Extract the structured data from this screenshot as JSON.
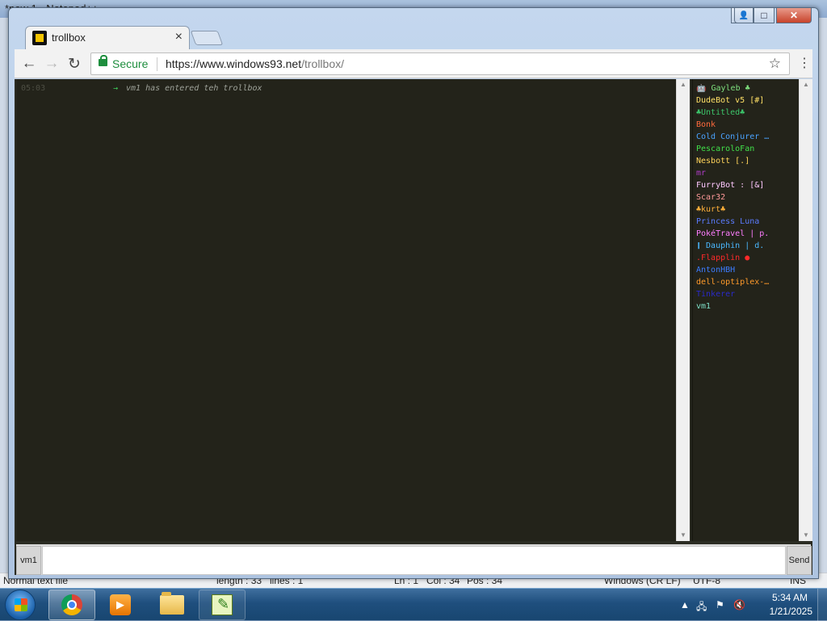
{
  "background_app": {
    "title": "*new 1 - Notepad++",
    "status": {
      "type": "Normal text file",
      "length": "length : 33",
      "lines": "lines : 1",
      "ln": "Ln : 1",
      "col": "Col : 34",
      "pos": "Pos : 34",
      "eol": "Windows (CR LF)",
      "encoding": "UTF-8",
      "mode": "INS"
    }
  },
  "window": {
    "controls": {
      "user": "👤",
      "minimize": "—",
      "maximize": "□",
      "close": "✕"
    }
  },
  "tab": {
    "title": "trollbox",
    "close": "×"
  },
  "toolbar": {
    "back": "←",
    "forward": "→",
    "reload": "↻",
    "secure_label": "Secure",
    "url_host": "https://www.windows93.net",
    "url_path": "/trollbox/",
    "star": "☆",
    "menu": "⋮"
  },
  "chat": {
    "messages": [
      {
        "time": "05:03",
        "arrow": "→",
        "text": "vm1 has entered teh trollbox"
      }
    ]
  },
  "users": [
    {
      "name": "🤖 Gayleb ♣",
      "color": "#7ee07e"
    },
    {
      "name": "DudeBot v5 [#]",
      "color": "#ffe066"
    },
    {
      "name": "♣Untitled♣",
      "color": "#3cc46a"
    },
    {
      "name": "Bonk",
      "color": "#ff6a3d"
    },
    {
      "name": "Cold Conjurer …",
      "color": "#4aa3ff"
    },
    {
      "name": "PescaroloFan",
      "color": "#41e04a"
    },
    {
      "name": "Nesbott [.]",
      "color": "#ffd45a"
    },
    {
      "name": "mr",
      "color": "#b03cc8"
    },
    {
      "name": "FurryBot : [&]",
      "color": "#ffc8ff"
    },
    {
      "name": "Scar32",
      "color": "#ff9a9a"
    },
    {
      "name": "♣kurt♣",
      "color": "#ffb03a"
    },
    {
      "name": "Princess Luna",
      "color": "#5b7cff"
    },
    {
      "name": "PokéTravel | p.",
      "color": "#ff7dff"
    },
    {
      "name": "❙ Dauphin | d.",
      "color": "#4ab8ff"
    },
    {
      "name": ".Flapplin ●",
      "color": "#ff2a2a"
    },
    {
      "name": "AntonHBH",
      "color": "#3c7cff"
    },
    {
      "name": "dell-optiplex-…",
      "color": "#ff9a2a"
    },
    {
      "name": "Tinkerer",
      "color": "#2a2ac8"
    },
    {
      "name": "vm1",
      "color": "#7ee0c8"
    }
  ],
  "input": {
    "nick": "vm1",
    "send": "Send",
    "value": ""
  },
  "taskbar": {
    "time": "5:34 AM",
    "date": "1/21/2025"
  }
}
